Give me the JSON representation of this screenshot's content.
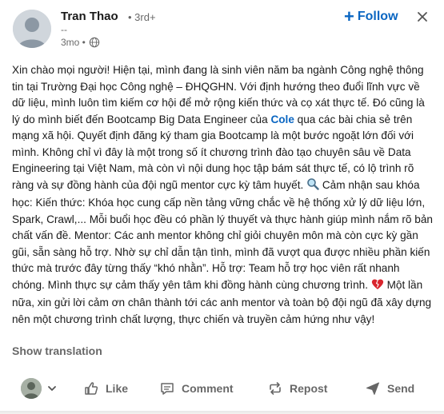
{
  "post": {
    "author_name": "Tran Thao",
    "degree": "• 3rd+",
    "subline": "--",
    "time": "3mo •",
    "follow_label": "Follow",
    "text_part1": "Xin chào mọi người! Hiện tại, mình đang là sinh viên năm ba ngành Công nghệ thông tin tại Trường Đại học Công nghệ – ĐHQGHN. Với định hướng theo đuổi lĩnh vực về dữ liệu, mình luôn tìm kiếm cơ hội để mở rộng kiến thức và cọ xát thực tế. Đó cũng là lý do mình biết đến Bootcamp Big Data Engineer của ",
    "mention": "Cole",
    "text_part2": " qua các bài chia sẻ trên mạng xã hội. Quyết định đăng ký tham gia Bootcamp là một bước ngoặt lớn đối với mình. Không chỉ vì đây là một trong số ít chương trình đào tạo chuyên sâu về Data Engineering tại Việt Nam, mà còn vì nội dung học tập bám sát thực tế, có lộ trình rõ ràng và sự đồng hành của đội ngũ mentor cực kỳ tâm huyết. ",
    "text_part3": " Cảm nhận sau khóa học: Kiến thức: Khóa học cung cấp nền tảng vững chắc về hệ thống xử lý dữ liệu lớn, Spark, Crawl,... Mỗi buổi học đều có phần lý thuyết và thực hành giúp mình nắm rõ bản chất vấn đề. Mentor: Các anh mentor không chỉ giỏi chuyên môn mà còn cực kỳ gần gũi, sẵn sàng hỗ trợ. Nhờ sự chỉ dẫn tận tình, mình đã vượt qua được nhiều phần kiến thức mà trước đây từng thấy “khó nhằn”. Hỗ trợ: Team hỗ trợ học viên rất nhanh chóng. Mình thực sự cảm thấy yên tâm khi đồng hành cùng chương trình. ",
    "text_part4": " Một lần nữa, xin gửi lời cảm ơn chân thành tới các anh mentor và toàn bộ đội ngũ đã xây dựng nên một chương trình chất lượng, thực chiến và truyền cảm hứng như vậy!",
    "show_translation": "Show translation"
  },
  "actions": {
    "like": "Like",
    "comment": "Comment",
    "repost": "Repost",
    "send": "Send"
  },
  "colors": {
    "accent": "#0a66c2",
    "muted": "#666666"
  },
  "icons": [
    "globe-icon",
    "plus-icon",
    "close-icon",
    "magnifier-emoji-icon",
    "broken-heart-emoji-icon",
    "chevron-down-icon",
    "like-icon",
    "comment-icon",
    "repost-icon",
    "send-icon"
  ]
}
